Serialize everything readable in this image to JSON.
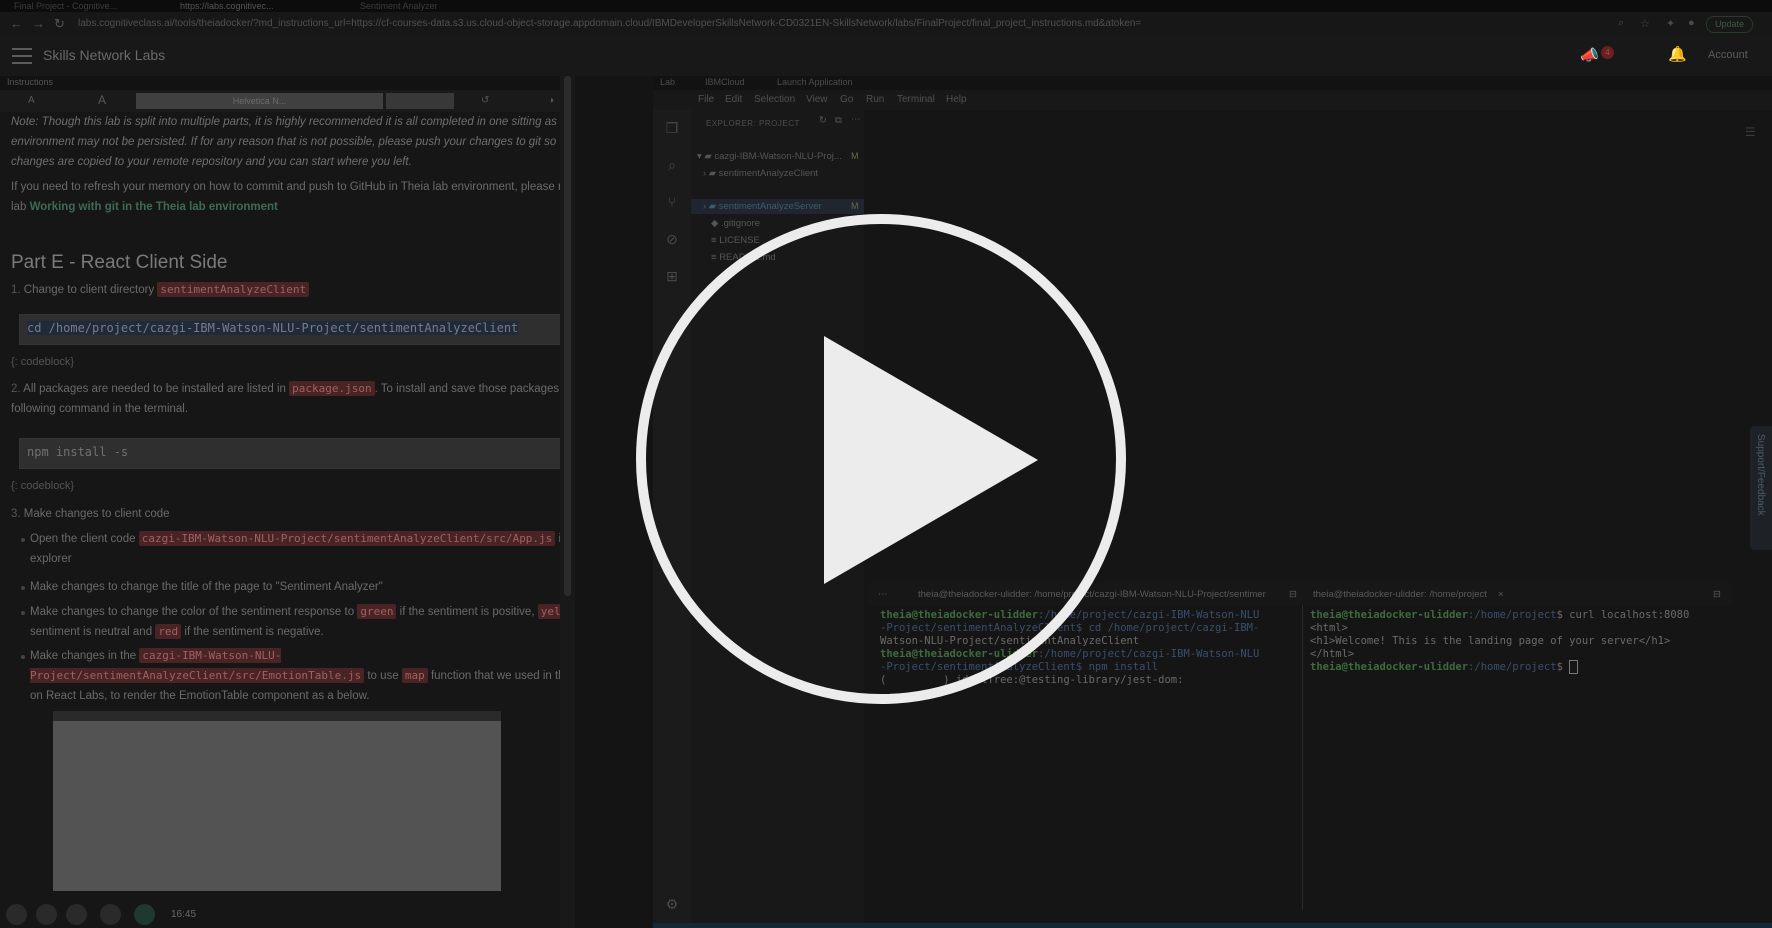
{
  "browser": {
    "tabs": [
      "Final Project - Cognitive...",
      "https://labs.cognitivec...",
      "Sentiment Analyzer"
    ],
    "url": "labs.cognitiveclass.ai/tools/theiadocker/?md_instructions_url=https://cf-courses-data.s3.us.cloud-object-storage.appdomain.cloud/IBMDeveloperSkillsNetwork-CD0321EN-SkillsNetwork/labs/FinalProject/final_project_instructions.md&atoken=",
    "update_label": "Update"
  },
  "app": {
    "brand": "Skills Network Labs",
    "notification_count": "4",
    "account_label": "Account"
  },
  "instructions": {
    "tab_label": "Instructions",
    "toolbar": {
      "font_smaller": "A",
      "font_larger": "A",
      "font_family": "Helvetica N..."
    },
    "note": "Note: Though this lab is split into multiple parts, it is highly recommended it is all completed in one sitting as the project environment may not be persisted. If for any reason that is not possible, please push your changes to git so that the changes are copied to your remote repository and you can start where you left.",
    "refresh_text": "If you need to refresh your memory on how to commit and push to GitHub in Theia lab environment, please refer to this lab",
    "refresh_link": "Working with git in the Theia lab environment",
    "heading": "Part E - React Client Side",
    "step1_num": "1.",
    "step1_text": "Change to client directory",
    "step1_code": "sentimentAnalyzeClient",
    "codeblock1": "cd /home/project/cazgi-IBM-Watson-NLU-Project/sentimentAnalyzeClient",
    "codeblock_label": "{: codeblock}",
    "step2_num": "2.",
    "step2_text_a": "All packages are needed to be installed are listed in",
    "step2_code": "package.json",
    "step2_text_b": ". To install and save those packages, run the following command in the terminal.",
    "codeblock2": "npm install -s",
    "step3_num": "3.",
    "step3_text": "Make changes to client code",
    "bullet1_a": "Open the client code",
    "bullet1_code": "cazgi-IBM-Watson-NLU-Project/sentimentAnalyzeClient/src/App.js",
    "bullet1_b": "in the explorer",
    "bullet2": "Make changes to change the title of the page to \"Sentiment Analyzer\"",
    "bullet3_a": "Make changes to change the color of the sentiment response to",
    "bullet3_green": "green",
    "bullet3_b": "if the sentiment is positive,",
    "bullet3_yellow": "yellow",
    "bullet3_c": "if the sentiment is neutral and",
    "bullet3_red": "red",
    "bullet3_d": "if the sentiment is negative.",
    "bullet4_a": "Make changes in the",
    "bullet4_code": "cazgi-IBM-Watson-NLU-Project/sentimentAnalyzeClient/src/EmotionTable.js",
    "bullet4_b": "to use",
    "bullet4_map": "map",
    "bullet4_c": "function that we used in the Hands-on React Labs, to render the EmotionTable component as a below.",
    "media_time": "16:45"
  },
  "ide": {
    "tabs": [
      "Lab",
      "IBMCloud",
      "Launch Application"
    ],
    "menu": [
      "File",
      "Edit",
      "Selection",
      "View",
      "Go",
      "Run",
      "Terminal",
      "Help"
    ],
    "explorer_title": "EXPLORER: PROJECT",
    "tree": {
      "root": "cazgi-IBM-Watson-NLU-Proj...",
      "root_mod": "M",
      "client": "sentimentAnalyzeClient",
      "server": "sentimentAnalyzeServer",
      "server_mod": "M",
      "gitignore": ".gitignore",
      "license": "LICENSE",
      "readme": "README.md"
    },
    "support_label": "Support/Feedback"
  },
  "terminals": {
    "tab1": "theia@theiadocker-ulidder: /home/project/cazgi-IBM-Watson-NLU-Project/sentimer",
    "tab2": "theia@theiadocker-ulidder: /home/project",
    "left": {
      "l1_user": "theia@theiadocker-ulidder",
      "l1_path": ":/home/project/cazgi-IBM-Watson-NLU",
      "l2": "-Project/sentimentAnalyzeClient$ cd /home/project/cazgi-IBM-",
      "l3": "Watson-NLU-Project/sentimentAnalyzeClient",
      "l4_user": "theia@theiadocker-ulidder",
      "l4_path": ":/home/project/cazgi-IBM-Watson-NLU",
      "l5": "-Project/sentimentAnalyzeClient$ npm install",
      "l6": "(         ) idealTree:@testing-library/jest-dom:"
    },
    "right": {
      "l1_user": "theia@theiadocker-ulidder",
      "l1_path": ":/home/project",
      "l1_cmd": "$ curl localhost:8080",
      "l2": "<html>",
      "l3": "<h1>Welcome! This is the landing page of your server</h1>",
      "l4": "</html>",
      "l5_user": "theia@theiadocker-ulidder",
      "l5_path": ":/home/project",
      "l5_cmd": "$ "
    }
  }
}
